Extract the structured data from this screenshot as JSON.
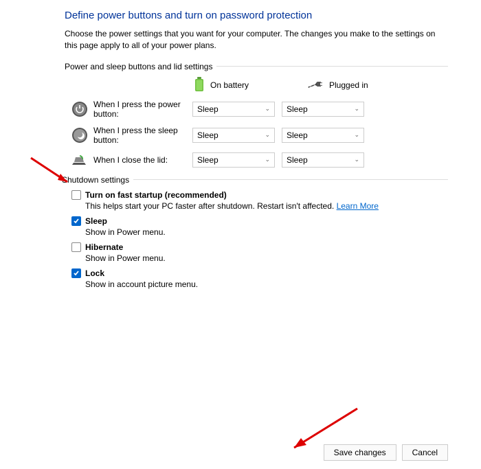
{
  "title": "Define power buttons and turn on password protection",
  "desc": "Choose the power settings that you want for your computer. The changes you make to the settings on this page apply to all of your power plans.",
  "section1": "Power and sleep buttons and lid settings",
  "cols": {
    "battery": "On battery",
    "plugged": "Plugged in"
  },
  "rows": {
    "power": {
      "label": "When I press the power button:",
      "battery": "Sleep",
      "plugged": "Sleep"
    },
    "sleep": {
      "label": "When I press the sleep button:",
      "battery": "Sleep",
      "plugged": "Sleep"
    },
    "lid": {
      "label": "When I close the lid:",
      "battery": "Sleep",
      "plugged": "Sleep"
    }
  },
  "section2": "Shutdown settings",
  "shutdown": {
    "fast": {
      "label": "Turn on fast startup (recommended)",
      "sub_pre": "This helps start your PC faster after shutdown. Restart isn't affected. ",
      "link": "Learn More",
      "checked": false
    },
    "sleep": {
      "label": "Sleep",
      "sub": "Show in Power menu.",
      "checked": true
    },
    "hiber": {
      "label": "Hibernate",
      "sub": "Show in Power menu.",
      "checked": false
    },
    "lock": {
      "label": "Lock",
      "sub": "Show in account picture menu.",
      "checked": true
    }
  },
  "buttons": {
    "save": "Save changes",
    "cancel": "Cancel"
  }
}
